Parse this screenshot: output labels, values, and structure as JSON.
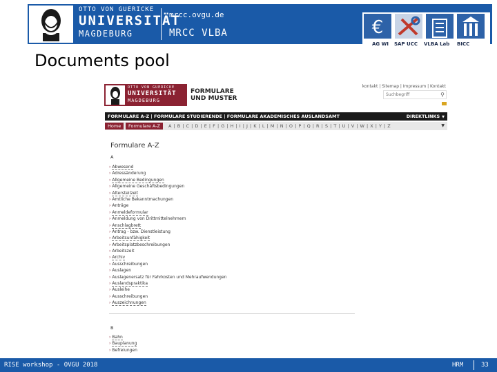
{
  "header": {
    "uni_line1": "OTTO VON GUERICKE",
    "uni_line2": "UNIVERSITÄT",
    "uni_line3": "MAGDEBURG",
    "url": "mrcc.ovgu.de",
    "section": "MRCC VLBA"
  },
  "partners": [
    "AG WI",
    "SAP UCC",
    "VLBA Lab",
    "BICC"
  ],
  "page_title": "Documents pool",
  "website": {
    "logo_line1": "OTTO VON GUERICKE",
    "logo_line2": "UNIVERSITÄT",
    "logo_line3": "MAGDEBURG",
    "section_line1": "FORMULARE",
    "section_line2": "UND MUSTER",
    "top_links": "kontakt | Sitemap | Impressum | Kontakt",
    "search_placeholder": "Suchbegriff",
    "nav_text": "FORMULARE A-Z  |  FORMULARE STUDIERENDE  |  FORMULARE AKADEMISCHES AUSLANDSAMT",
    "nav_right": "DIREKTLINKS",
    "crumb_home": "Home",
    "crumb_current": "Formulare A-Z",
    "letters": "A | B | C | D | E | F | G | H | I | J | K | L | M | N | O | P | Q | R | S | T | U | V | W | X | Y | Z",
    "heading": "Formulare A-Z",
    "letter_a": "A",
    "items_a": [
      {
        "label": "Abwesend",
        "underline": true
      },
      {
        "label": "Adressänderung",
        "underline": false
      },
      {
        "label": "Allgemeine Bedingungen",
        "underline": true
      },
      {
        "label": "Allgemeine Geschäftsbedingungen",
        "underline": false
      },
      {
        "label": "Altersteilzeit",
        "underline": true
      },
      {
        "label": "Amtliche Bekanntmachungen",
        "underline": false
      },
      {
        "label": "Anträge",
        "underline": false
      },
      {
        "label": "Anmeldeformular",
        "underline": true
      },
      {
        "label": "Anmeldung von Drittmittelnehmern",
        "underline": false
      },
      {
        "label": "Anschlagbrett",
        "underline": true
      },
      {
        "label": "Antrag - bzw. Dienstleistung",
        "underline": false
      },
      {
        "label": "Arbeitsunfähigkeit",
        "underline": true
      },
      {
        "label": "Arbeitsplatzbeschreibungen",
        "underline": false
      },
      {
        "label": "Arbeitszeit",
        "underline": false
      },
      {
        "label": "Archiv",
        "underline": true
      },
      {
        "label": "Ausschreibungen",
        "underline": false
      },
      {
        "label": "Auslagen",
        "underline": false
      },
      {
        "label": "Auslagenersatz für Fahrkosten und Mehraufwendungen",
        "underline": false
      },
      {
        "label": "Auslandspraktika",
        "underline": true
      },
      {
        "label": "Ausleihe",
        "underline": false
      },
      {
        "label": "Ausschreibungen",
        "underline": false
      },
      {
        "label": "Auszeichnungen",
        "underline": true
      }
    ],
    "letter_b": "B",
    "items_b": [
      {
        "label": "Bahn",
        "underline": true
      },
      {
        "label": "Bauplanung",
        "underline": true
      },
      {
        "label": "Befreiungen",
        "underline": false
      }
    ]
  },
  "footer": {
    "left": "RISE workshop - OVGU 2018",
    "right": "HRM",
    "page": "33"
  }
}
